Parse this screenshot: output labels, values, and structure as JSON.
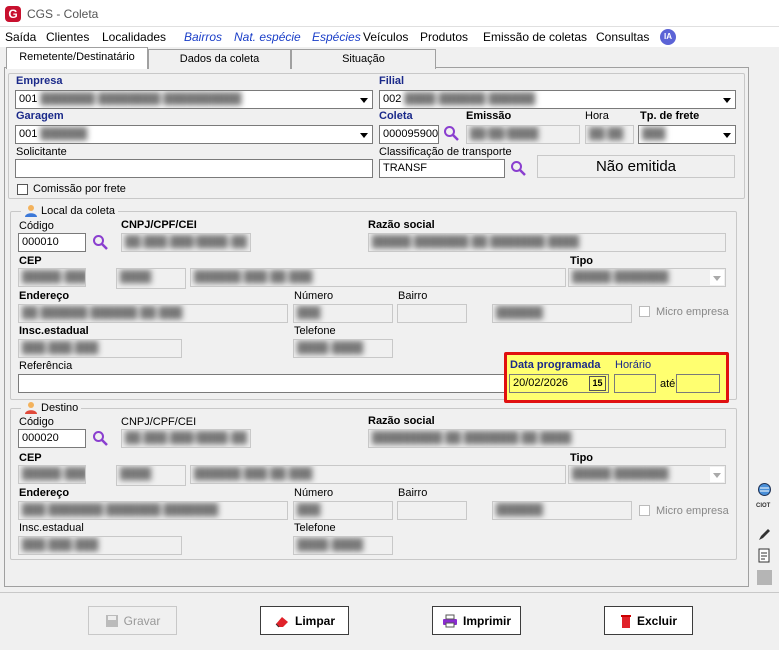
{
  "window": {
    "title": "CGS - Coleta"
  },
  "menu": [
    "Saída",
    "Clientes",
    "Localidades",
    "Bairros",
    "Nat. espécie",
    "Espécies",
    "Veículos",
    "Produtos",
    "Emissão de coletas",
    "Consultas"
  ],
  "menu_ia": "IA",
  "tabs": [
    "Remetente/Destinatário",
    "Dados da coleta",
    "Situação"
  ],
  "top": {
    "empresa_label": "Empresa",
    "empresa_value": "001",
    "filial_label": "Filial",
    "filial_value": "002",
    "garagem_label": "Garagem",
    "garagem_value": "001",
    "coleta_label": "Coleta",
    "coleta_value": "000095900",
    "emissao_label": "Emissão",
    "hora_label": "Hora",
    "tpfrete_label": "Tp. de frete",
    "solicitante_label": "Solicitante",
    "classif_label": "Classificação de transporte",
    "classif_value": "TRANSF",
    "status": "Não emitida",
    "comissao_label": "Comissão por frete"
  },
  "local": {
    "group": "Local da coleta",
    "codigo_label": "Código",
    "codigo_value": "000010",
    "cnpj_label": "CNPJ/CPF/CEI",
    "razao_label": "Razão social",
    "cep_label": "CEP",
    "tipo_label": "Tipo",
    "endereco_label": "Endereço",
    "numero_label": "Número",
    "bairro_label": "Bairro",
    "micro_label": "Micro empresa",
    "insc_label": "Insc.estadual",
    "telefone_label": "Telefone",
    "referencia_label": "Referência",
    "data_label": "Data programada",
    "horario_label": "Horário",
    "data_value": "20/02/2026",
    "ate_label": "até",
    "cal_label": "15"
  },
  "destino": {
    "group": "Destino",
    "codigo_label": "Código",
    "codigo_value": "000020",
    "cnpj_label": "CNPJ/CPF/CEI",
    "razao_label": "Razão social",
    "cep_label": "CEP",
    "tipo_label": "Tipo",
    "endereco_label": "Endereço",
    "numero_label": "Número",
    "bairro_label": "Bairro",
    "micro_label": "Micro empresa",
    "insc_label": "Insc.estadual",
    "telefone_label": "Telefone"
  },
  "buttons": {
    "gravar": "Gravar",
    "limpar": "Limpar",
    "imprimir": "Imprimir",
    "excluir": "Excluir"
  },
  "side": {
    "ciot": "CIOT"
  },
  "colors": {
    "accent_highlight": "#ffff70",
    "highlight_border": "#e01010",
    "menu_blue": "#1a3ec8",
    "label_navy": "#1b2a8a"
  }
}
